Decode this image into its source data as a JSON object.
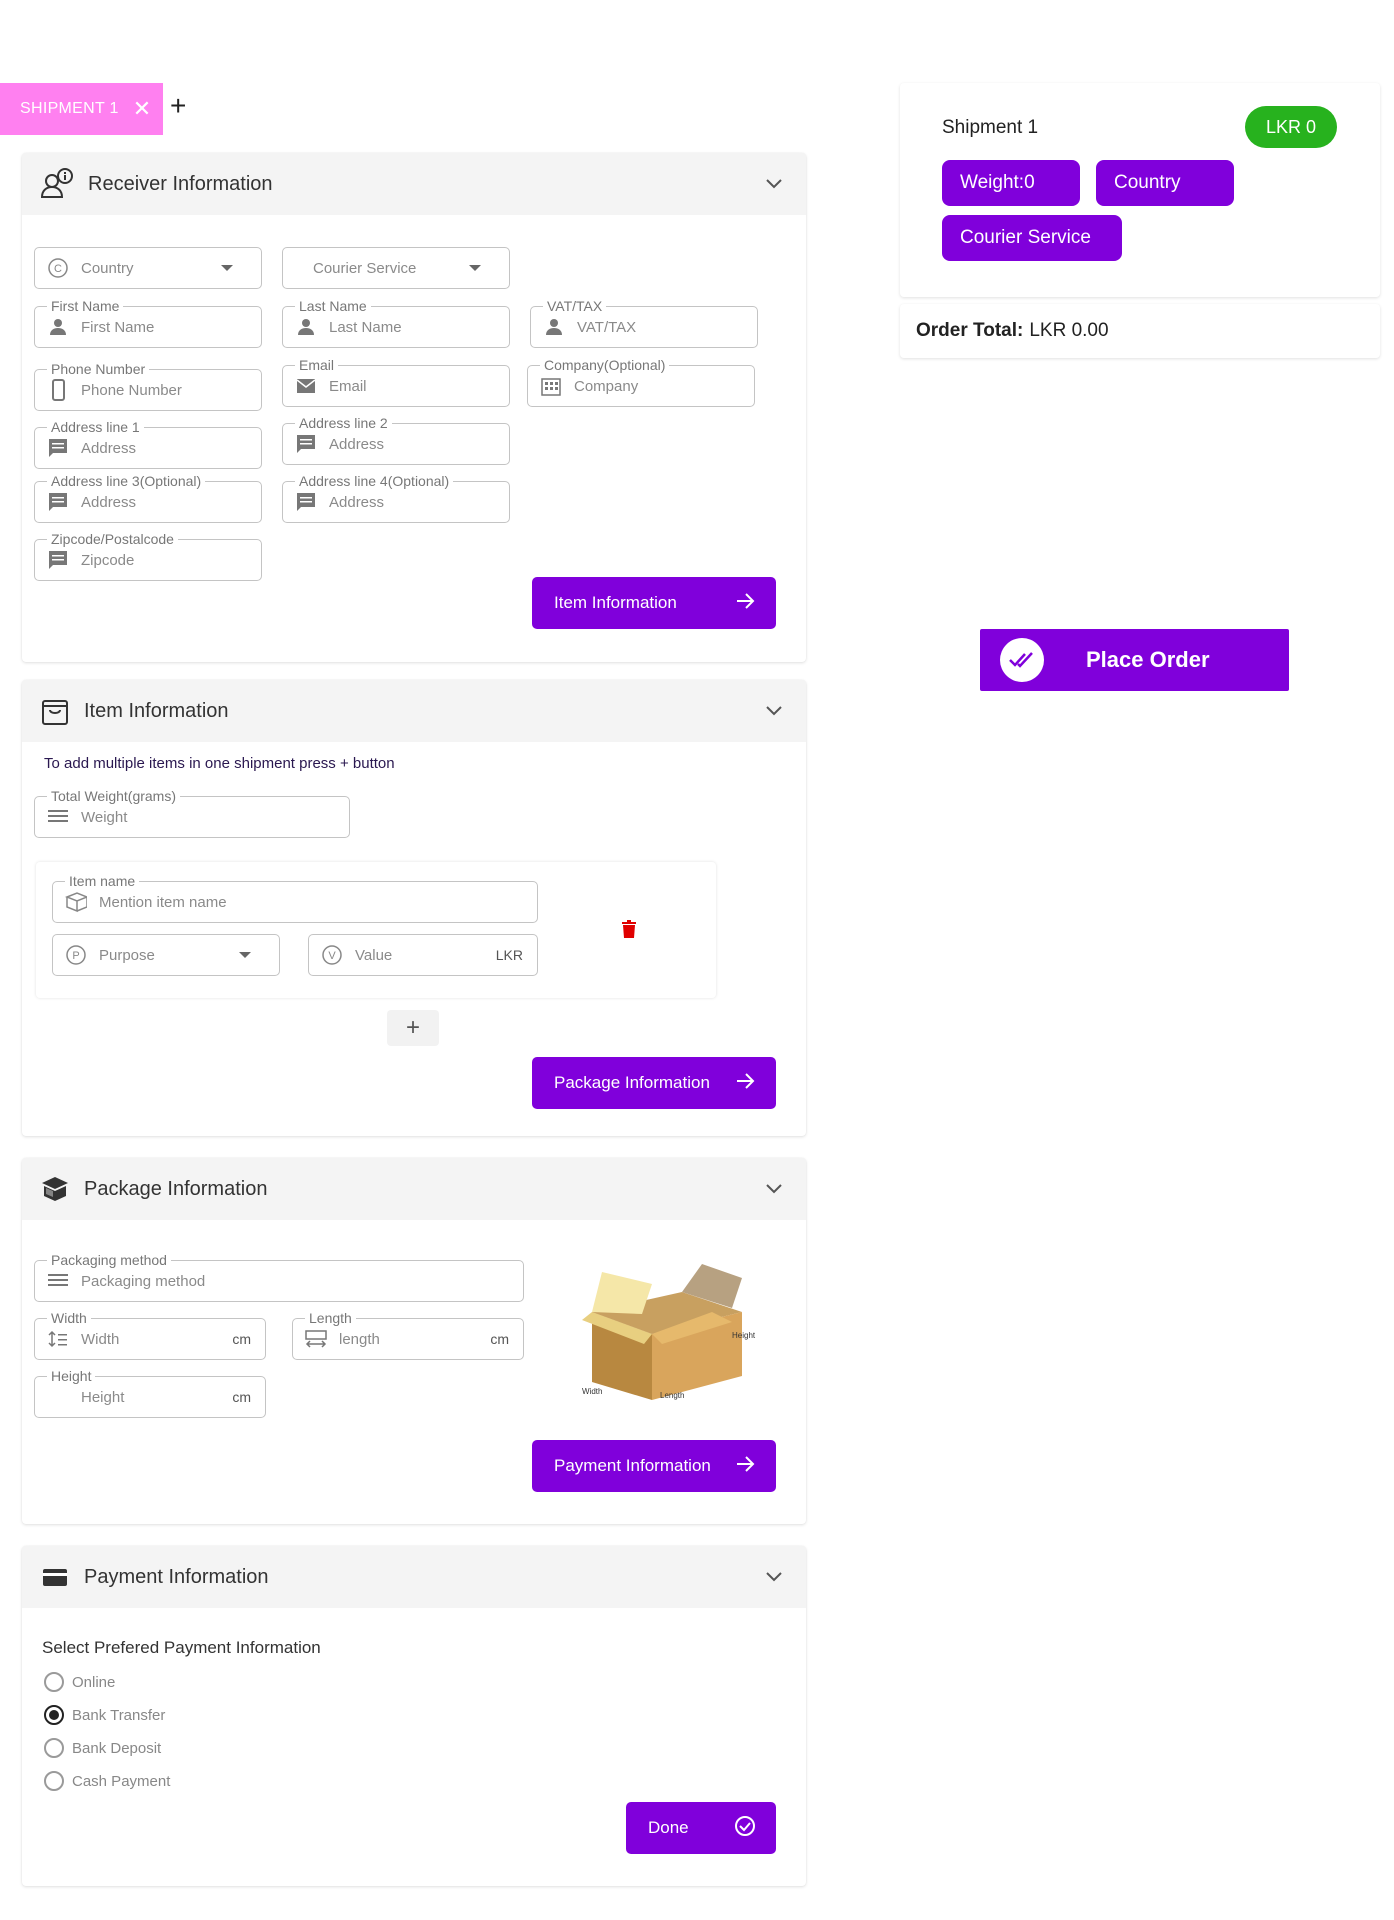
{
  "tabs": {
    "active_label": "SHIPMENT 1",
    "add_label": "+"
  },
  "receiver": {
    "title": "Receiver Information",
    "country_placeholder": "Country",
    "courier_placeholder": "Courier Service",
    "first_name_label": "First Name",
    "first_name_placeholder": "First Name",
    "last_name_label": "Last Name",
    "last_name_placeholder": "Last Name",
    "vat_label": "VAT/TAX",
    "vat_placeholder": "VAT/TAX",
    "phone_label": "Phone Number",
    "phone_placeholder": "Phone Number",
    "email_label": "Email",
    "email_placeholder": "Email",
    "company_label": "Company(Optional)",
    "company_placeholder": "Company",
    "address1_label": "Address line 1",
    "address2_label": "Address line 2",
    "address3_label": "Address line 3(Optional)",
    "address4_label": "Address line 4(Optional)",
    "address_placeholder": "Address",
    "zip_label": "Zipcode/Postalcode",
    "zip_placeholder": "Zipcode",
    "next_label": "Item Information"
  },
  "item": {
    "title": "Item Information",
    "hint": "To add multiple items in one shipment press + button",
    "weight_label": "Total Weight(grams)",
    "weight_placeholder": "Weight",
    "name_label": "Item name",
    "name_placeholder": "Mention item name",
    "purpose_placeholder": "Purpose",
    "value_placeholder": "Value",
    "value_unit": "LKR",
    "add_label": "+",
    "next_label": "Package Information"
  },
  "package": {
    "title": "Package Information",
    "method_label": "Packaging method",
    "method_placeholder": "Packaging method",
    "width_label": "Width",
    "width_placeholder": "Width",
    "length_label": "Length",
    "length_placeholder": "length",
    "height_label": "Height",
    "height_placeholder": "Height",
    "unit": "cm",
    "box_labels": {
      "height": "Height",
      "width": "Width",
      "length": "Length"
    },
    "next_label": "Payment  Information"
  },
  "payment": {
    "title": "Payment Information",
    "prompt": "Select Prefered Payment Information",
    "options": [
      "Online",
      "Bank Transfer",
      "Bank Deposit",
      "Cash Payment"
    ],
    "selected": "Bank Transfer",
    "done_label": "Done"
  },
  "summary": {
    "title": "Shipment 1",
    "price_badge": "LKR 0",
    "weight_chip": "Weight:0",
    "country_chip": "Country",
    "courier_chip": "Courier Service",
    "order_total_label": "Order Total:",
    "order_total_value": "LKR 0.00",
    "place_order_label": "Place Order"
  },
  "colors": {
    "accent": "#8000db",
    "tab": "#ff80f0",
    "badge": "#27b21e",
    "delete": "#e00000"
  }
}
